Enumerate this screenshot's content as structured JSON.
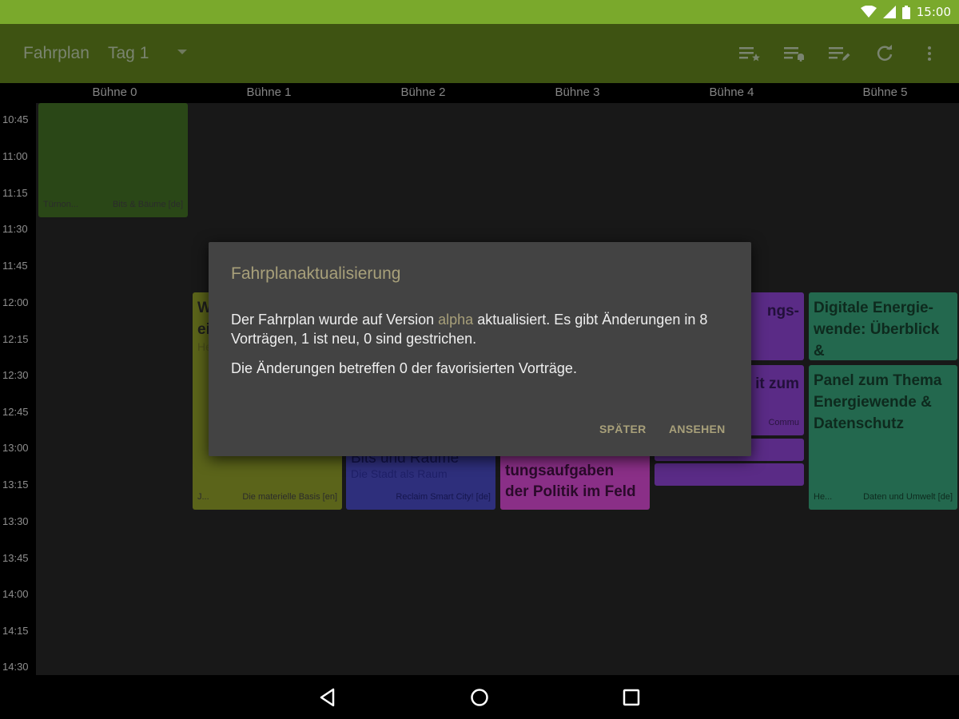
{
  "status_bar": {
    "time": "15:00"
  },
  "toolbar": {
    "title": "Fahrplan",
    "day": "Tag 1",
    "actions": [
      "favorites-list-icon",
      "alarms-list-icon",
      "changes-list-icon",
      "refresh-icon",
      "overflow-menu-icon"
    ]
  },
  "stages": [
    "Bühne 0",
    "Bühne 1",
    "Bühne 2",
    "Bühne 3",
    "Bühne 4",
    "Bühne 5"
  ],
  "times": [
    "10:45",
    "11:00",
    "11:15",
    "11:30",
    "11:45",
    "12:00",
    "12:15",
    "12:30",
    "12:45",
    "13:00",
    "13:15",
    "13:30",
    "13:45",
    "14:00",
    "14:15",
    "14:30"
  ],
  "events": {
    "e0": {
      "foot_left": "Türnon...",
      "foot_right": "Bits & Bäume [de]"
    },
    "e1": {
      "title": "W\nei",
      "sub": "He",
      "foot_left": "J...",
      "foot_right": "Die materielle Basis [en]"
    },
    "e2": {
      "title": "Bits und Räume",
      "sub": "Die Stadt als Raum",
      "foot_right": "Reclaim Smart City! [de]"
    },
    "e3": {
      "title": "tungsaufgaben\nder Politik im Feld"
    },
    "e4a": {
      "title": "ngs-"
    },
    "e4b": {
      "title": "it zum",
      "foot_right": "Commu"
    },
    "e5a": {
      "title": "Digitale Energie-\nwende: Überblick &\nElevator Pitches"
    },
    "e5b": {
      "title": "Panel zum Thema\nEnergiewende &\nDatenschutz",
      "foot_left": "He...",
      "foot_right": "Daten und Umwelt [de]"
    }
  },
  "dialog": {
    "title": "Fahrplanaktualisierung",
    "body_before": "Der Fahrplan wurde auf Version ",
    "body_version": "alpha",
    "body_after": " aktualisiert. Es gibt Änderungen in 8 Vorträgen, 1 ist neu, 0 sind gestrichen.",
    "body2": "Die Änderungen betreffen 0 der favorisierten Vorträge.",
    "later_label": "SPÄTER",
    "view_label": "ANSEHEN"
  },
  "colors": {
    "status_bar": "#7aa92c",
    "toolbar": "#3e5312",
    "stage0": "#2a4717",
    "stage1": "#5b641a",
    "stage2": "#2e2f7c",
    "stage3": "#8a2f87",
    "stage4": "#5a2b86",
    "stage5": "#23684e",
    "accent": "#a8a07a"
  }
}
